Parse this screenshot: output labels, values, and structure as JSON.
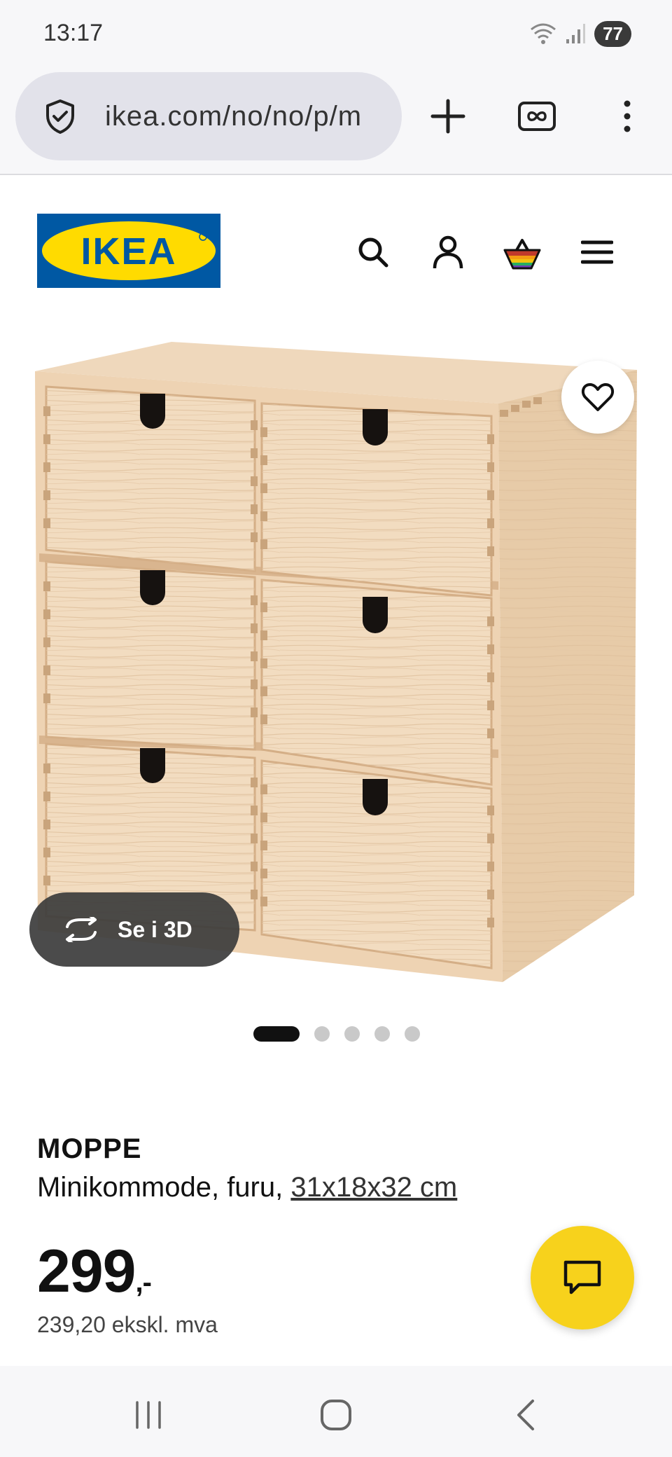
{
  "status_bar": {
    "time": "13:17",
    "battery": "77"
  },
  "browser": {
    "url": "ikea.com/no/no/p/m"
  },
  "site": {
    "logo_text": "IKEA"
  },
  "product": {
    "name": "MOPPE",
    "description": "Minikommode, furu, ",
    "dimensions": "31x18x32 cm",
    "price_main": "299",
    "price_suffix": ",-",
    "price_ex_vat": "239,20 ekskl. mva",
    "view_3d_label": "Se i 3D",
    "image_count": 5,
    "active_image": 1
  },
  "colors": {
    "ikea_blue": "#0058a3",
    "ikea_yellow": "#ffdb00",
    "chat_yellow": "#f7d21c",
    "wood": "#ecd2b4"
  }
}
